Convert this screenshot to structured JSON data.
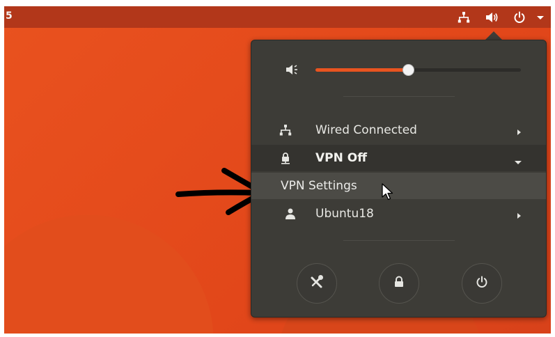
{
  "topbar": {
    "clock_fragment": "5",
    "icons": [
      "network-wired-icon",
      "volume-icon",
      "power-icon",
      "chevron-down-icon"
    ]
  },
  "menu": {
    "volume": {
      "icon": "speaker-icon",
      "level_percent": 45
    },
    "items": [
      {
        "label": "Wired Connected",
        "icon": "network-wired-icon",
        "indicator": "chevron-right"
      },
      {
        "label": "VPN Off",
        "icon": "vpn-lock-icon",
        "indicator": "chevron-down"
      },
      {
        "label": "VPN Settings"
      },
      {
        "label": "Ubuntu18",
        "icon": "user-icon",
        "indicator": "chevron-right"
      }
    ],
    "buttons": [
      "settings-icon",
      "lock-icon",
      "power-icon"
    ]
  },
  "colors": {
    "accent": "#e95420",
    "menu_bg": "#3d3c37",
    "topbar_bg": "#b2371a"
  }
}
